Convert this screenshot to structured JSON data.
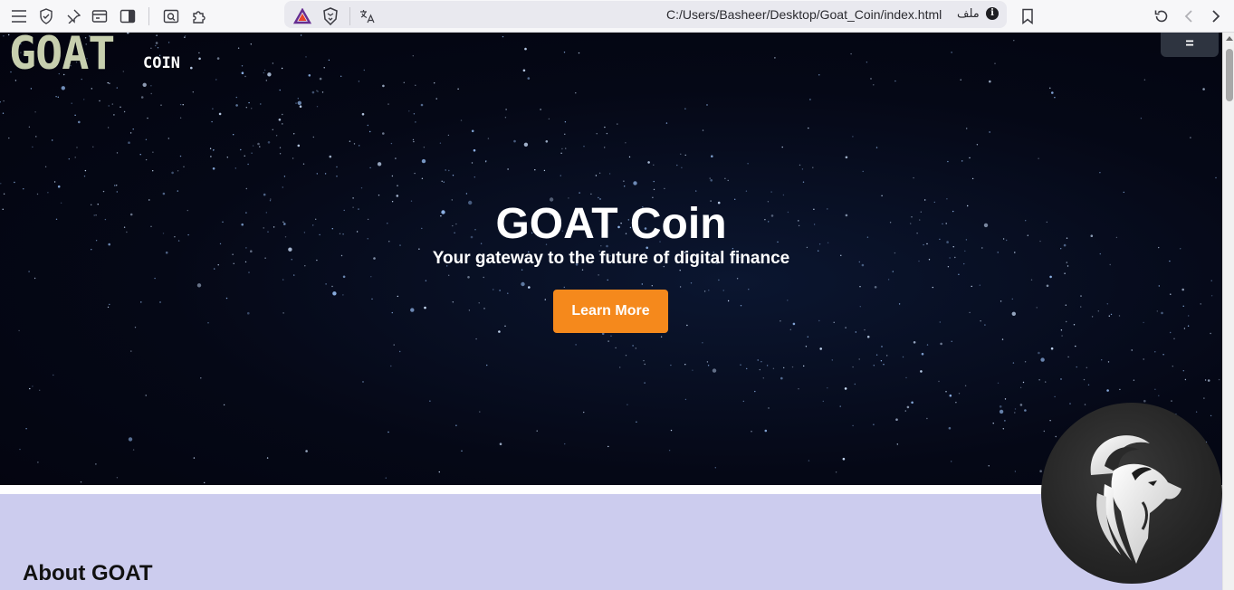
{
  "browser": {
    "url": "C:/Users/Basheer/Desktop/Goat_Coin/index.html",
    "file_label": "ملف",
    "info_icon": "i",
    "icons": [
      "menu-icon",
      "shield-icon",
      "pin-icon",
      "screen-capture-icon",
      "sidebar-icon",
      "search-page-icon",
      "extensions-icon",
      "brave-rewards-icon",
      "brave-shield-icon",
      "translate-icon",
      "bookmark-icon",
      "reload-icon",
      "back-icon",
      "forward-icon"
    ]
  },
  "site": {
    "logo_word": "GOAT",
    "logo_sub": "COIN",
    "menu_label": "=",
    "hero_title": "GOAT Coin",
    "hero_subtitle": "Your gateway to the future of digital finance",
    "cta_label": "Learn More",
    "about_title": "About GOAT"
  },
  "colors": {
    "cta": "#f5891c",
    "logo": "#c7cfae",
    "about_bg": "#ccccee",
    "hero_bg": "#050816"
  }
}
